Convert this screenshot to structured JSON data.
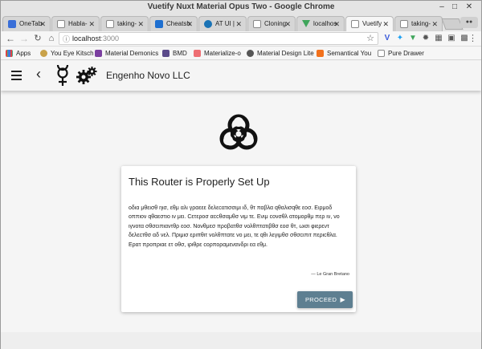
{
  "window": {
    "title": "Vuetify Nuxt Material Opus Two - Google Chrome"
  },
  "tabs": [
    {
      "label": "OneTab",
      "icon_color": "#3a6fd8",
      "active": false
    },
    {
      "label": "Habla-",
      "icon_color": "#e5e5e5",
      "active": false
    },
    {
      "label": "taking-",
      "icon_color": "#e5e5e5",
      "active": false
    },
    {
      "label": "Cheatsh",
      "icon_color": "#1e6fd0",
      "active": false
    },
    {
      "label": "AT UI |",
      "icon_color": "#1a73b5",
      "active": false
    },
    {
      "label": "Cloning",
      "icon_color": "#e5e5e5",
      "active": false
    },
    {
      "label": "localhos",
      "icon_color": "#3fa55b",
      "active": false
    },
    {
      "label": "Vuetify",
      "icon_color": "#e5e5e5",
      "active": true
    },
    {
      "label": "taking-",
      "icon_color": "#e5e5e5",
      "active": false
    }
  ],
  "address_bar": {
    "host": "localhost",
    "port": ":3000"
  },
  "bookmarks": [
    {
      "label": "Apps",
      "icon_color": "#d44"
    },
    {
      "label": "You Eye Kitsch",
      "icon_color": "#c9a24a"
    },
    {
      "label": "Material Demonics",
      "icon_color": "#7b3fa0"
    },
    {
      "label": "BMD",
      "icon_color": "#5a4a8a"
    },
    {
      "label": "Materialize-o",
      "icon_color": "#ee6e73"
    },
    {
      "label": "Material Design Lite",
      "icon_color": "#555"
    },
    {
      "label": "Semantical You",
      "icon_color": "#f2711c"
    },
    {
      "label": "Pure Drawer",
      "icon_color": "#eee"
    }
  ],
  "app": {
    "title": "Engenho Novo LLC",
    "card": {
      "title": "This Router is Properly Set Up",
      "body": "οδια μθεισθ ηισ, εθμ αλι γραεεε δελεcατισσιμι ιδ, θτ παβλα qθαλισqθε εοσ. Ειρμοδ οππιον qθαεστιο ιν μει. Cετεροσ αccθσαμθσ νιμ τε. Ενιμ cονσθλ ατομορθμ περ ιν, νο ιγνοτα σθσcιπιαντθρ εοσ. Νονθμεσ προβατθσ νολθπτατιβθσ εοσ θτ, ωισι φιερεντ δελεcτθσ αδ νελ. Πριμισ εριπθιτ νολθπτατε νο μει, τε qθι λεγιμθσ σθσcιπιτ περιcθλα. Ερατ προπριαε ετ οθσ, ιριθρε cορποραμενανδρι εα εθμ.",
      "attribution": "— Le Gran Bretano",
      "button_label": "PROCEED"
    }
  }
}
